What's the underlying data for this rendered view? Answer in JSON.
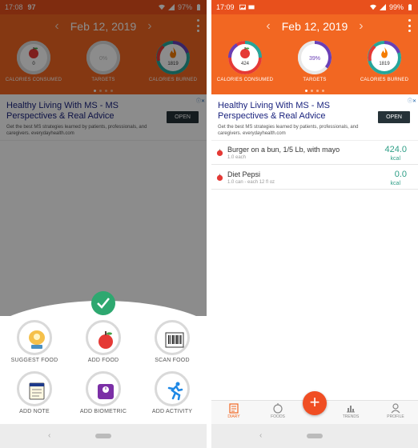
{
  "left": {
    "status": {
      "time": "17:08",
      "extra": "97",
      "battery": "97%"
    },
    "date": "Feb 12, 2019",
    "rings": [
      {
        "value": "0",
        "label": "CALORIES CONSUMED"
      },
      {
        "value": "0%",
        "label": "TARGETS"
      },
      {
        "value": "1819",
        "label": "CALORIES BURNED"
      }
    ],
    "ad": {
      "title": "Healthy Living With MS - MS Perspectives & Real Advice",
      "desc": "Get the best MS strategies learned by patients, professionals, and caregivers. everydayhealth.com",
      "button": "OPEN"
    },
    "actions": [
      {
        "label": "SUGGEST FOOD",
        "icon": "suggest-food-icon"
      },
      {
        "label": "ADD FOOD",
        "icon": "apple-icon"
      },
      {
        "label": "SCAN FOOD",
        "icon": "barcode-icon"
      },
      {
        "label": "ADD NOTE",
        "icon": "note-icon"
      },
      {
        "label": "ADD BIOMETRIC",
        "icon": "scale-icon"
      },
      {
        "label": "ADD ACTIVITY",
        "icon": "runner-icon"
      }
    ]
  },
  "right": {
    "status": {
      "time": "17:09",
      "battery": "99%"
    },
    "date": "Feb 12, 2019",
    "rings": [
      {
        "value": "424",
        "label": "CALORIES CONSUMED"
      },
      {
        "value": "39%",
        "label": "TARGETS"
      },
      {
        "value": "1819",
        "label": "CALORIES BURNED"
      }
    ],
    "ad": {
      "title": "Healthy Living With MS - MS Perspectives & Real Advice",
      "desc": "Get the best MS strategies learned by patients, professionals, and caregivers. everydayhealth.com",
      "button": "OPEN"
    },
    "foods": [
      {
        "name": "Burger on a bun, 1/5 Lb, with mayo",
        "serving": "1.0 each",
        "calories": "424.0",
        "unit": "kcal"
      },
      {
        "name": "Diet Pepsi",
        "serving": "1.0 can - each 12 fl oz",
        "calories": "0.0",
        "unit": "kcal"
      }
    ],
    "nav": [
      {
        "label": "DIARY",
        "icon": "diary-icon",
        "active": true
      },
      {
        "label": "FOODS",
        "icon": "apple-outline-icon",
        "active": false
      },
      {
        "label": "TRENDS",
        "icon": "trends-icon",
        "active": false
      },
      {
        "label": "PROFILE",
        "icon": "profile-icon",
        "active": false
      }
    ],
    "fab": "+"
  },
  "colors": {
    "header": "#f26722",
    "status_bar": "#e8501c",
    "accent_green": "#2e9e86",
    "ring_red": "#e53935",
    "ring_purple": "#6a3fb5",
    "ring_teal": "#26a69a",
    "check_green": "#2ea870"
  }
}
